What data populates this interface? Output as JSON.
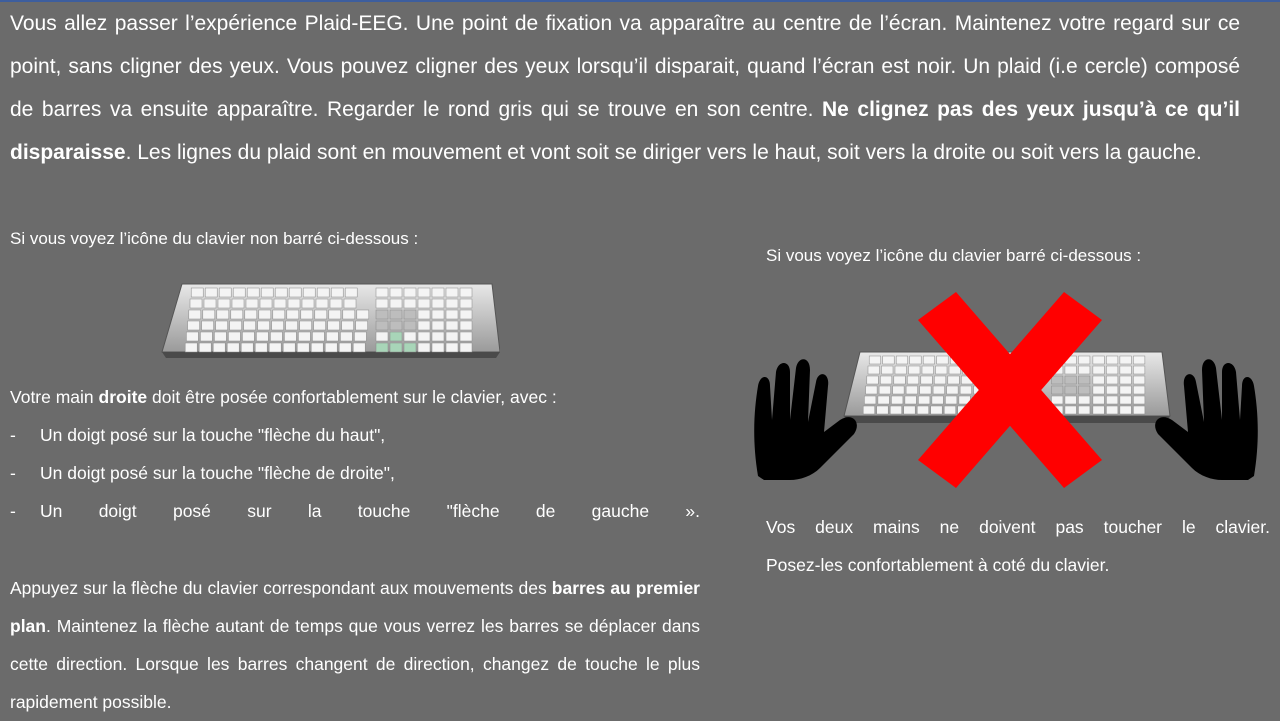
{
  "intro": {
    "text_before_bold": "Vous allez passer l’expérience Plaid-EEG. Une point de fixation va apparaître au centre de l’écran. Maintenez votre regard sur ce point, sans cligner des yeux. Vous pouvez cligner des yeux lorsqu’il disparait, quand l’écran est noir. Un plaid (i.e cercle) composé de barres va ensuite apparaître. Regarder le rond gris qui se trouve en son centre. ",
    "bold": "Ne clignez pas des yeux jusqu’à ce qu’il disparaisse",
    "text_after_bold": ". Les lignes du plaid sont en mouvement et vont soit se diriger vers le haut, soit vers la droite ou soit vers la gauche."
  },
  "left": {
    "heading": "Si vous voyez l’icône du clavier non barré ci-dessous :",
    "hand_intro_before": "Votre main ",
    "hand_intro_bold": "droite",
    "hand_intro_after": " doit être posée confortablement  sur le clavier, avec :",
    "bullets": [
      {
        "dash": "-",
        "text": "Un doigt posé sur la touche \"flèche du haut\","
      },
      {
        "dash": "-",
        "text": "Un doigt posé sur la touche \"flèche de droite\","
      },
      {
        "dash": "-",
        "text": "Un doigt posé sur la touche \"flèche de gauche »."
      }
    ],
    "para2_before": "Appuyez sur la flèche du clavier correspondant aux mouvements des ",
    "para2_bold": "barres au premier plan",
    "para2_after": ". Maintenez la flèche autant de temps que vous verrez les barres se déplacer dans cette direction. Lorsque les barres changent de direction, changez de touche le plus rapidement  possible."
  },
  "right": {
    "heading": "Si vous voyez l’icône du clavier barré ci-dessous :",
    "line1": "Vos deux mains ne doivent pas toucher le clavier.",
    "line2": "Posez-les confortablement  à coté du clavier."
  },
  "icons": {
    "keyboard": "keyboard-icon",
    "cross": "red-cross-icon",
    "hand": "hand-icon"
  },
  "colors": {
    "background": "#6b6b6b",
    "text": "#ffffff",
    "cross": "#ff0000",
    "arrow_keys": "#a8d5b8"
  }
}
